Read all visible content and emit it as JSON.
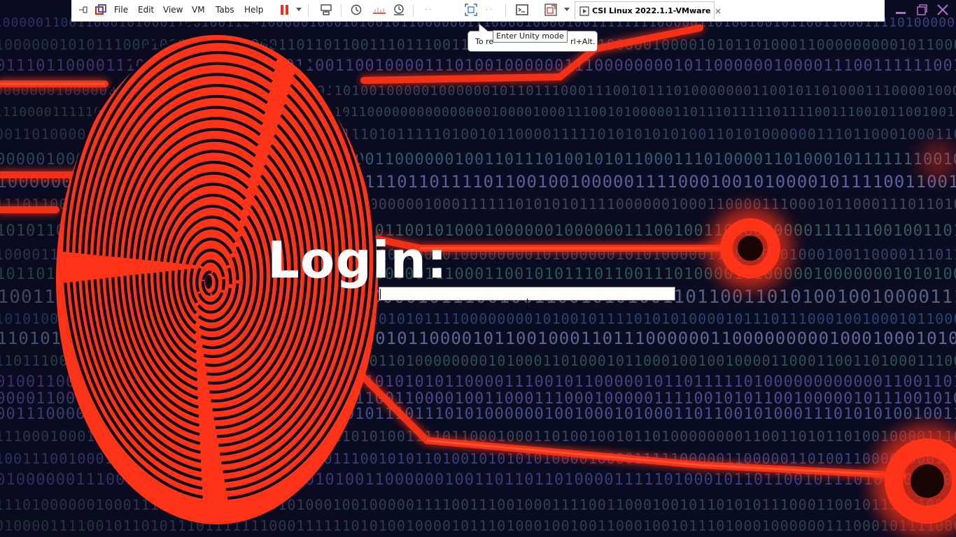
{
  "vmware_toolbar": {
    "menus": [
      "File",
      "Edit",
      "View",
      "VM",
      "Tabs",
      "Help"
    ],
    "tab_title": "CSI Linux 2022.1.1-VMware",
    "icons": [
      "unpin-icon",
      "vmware-logo-icon",
      "pause-icon",
      "dropdown-icon",
      "send-ctrl-alt-del-icon",
      "snapshot-icon",
      "revert-snapshot-icon",
      "manage-snapshots-icon",
      "full-screen-icon",
      "unity-icon",
      "console-view-icon",
      "stretch-icon",
      "minimize-icon",
      "restore-icon",
      "close-icon"
    ]
  },
  "balloon": {
    "text_start": "To re",
    "text_end": "rl+Alt."
  },
  "tooltip": {
    "text": "Enter Unity mode"
  },
  "login": {
    "label": "Login:",
    "input_value": ""
  },
  "colors": {
    "accent_red": "#ff3318",
    "background": "#0a0c22",
    "binary_blue": "#3b4f9a"
  }
}
